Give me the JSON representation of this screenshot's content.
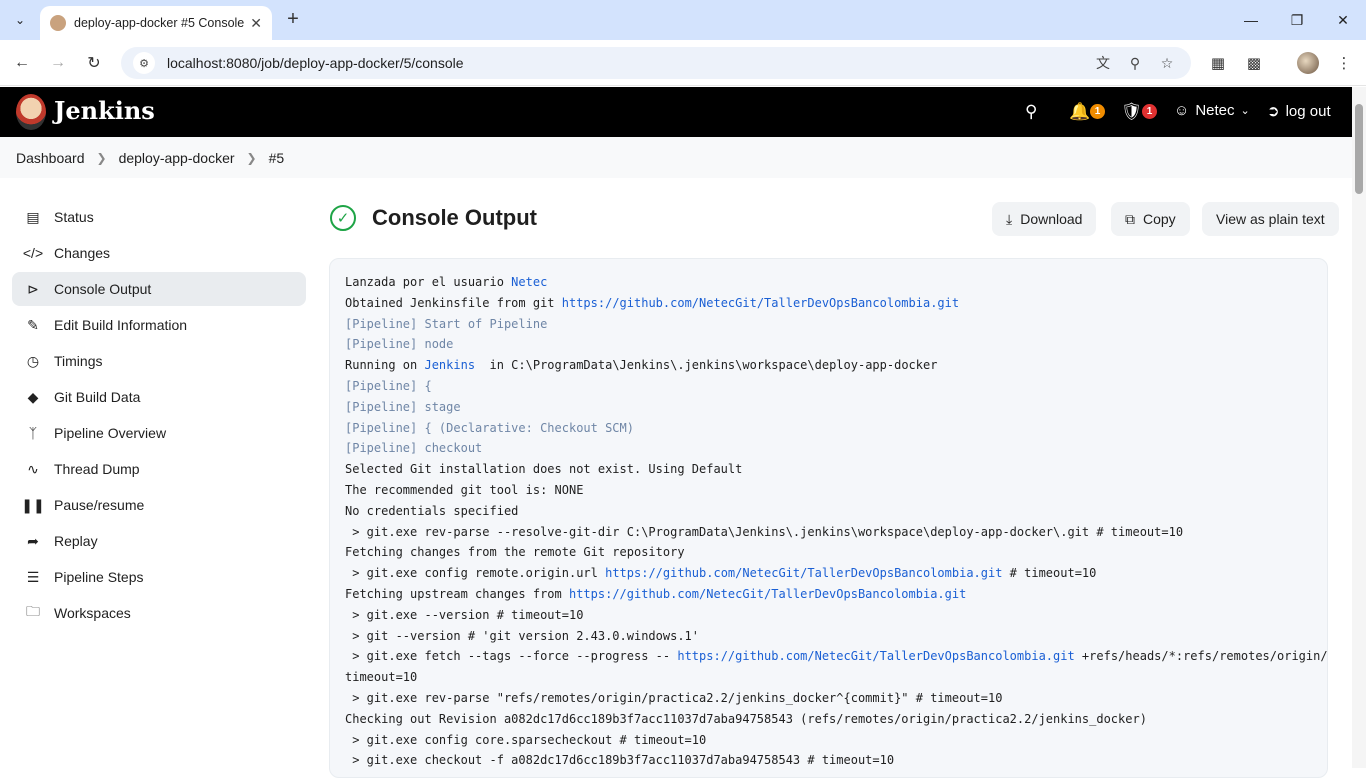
{
  "browser": {
    "tab_title": "deploy-app-docker #5 Console",
    "url": "localhost:8080/job/deploy-app-docker/5/console"
  },
  "jenkins": {
    "brand": "Jenkins",
    "notifications_count": "1",
    "security_count": "1",
    "user": "Netec",
    "logout": "log out"
  },
  "breadcrumb": [
    "Dashboard",
    "deploy-app-docker",
    "#5"
  ],
  "sidebar": {
    "items": [
      {
        "label": "Status",
        "icon": "document-icon"
      },
      {
        "label": "Changes",
        "icon": "code-icon"
      },
      {
        "label": "Console Output",
        "icon": "terminal-icon"
      },
      {
        "label": "Edit Build Information",
        "icon": "edit-icon"
      },
      {
        "label": "Timings",
        "icon": "stopwatch-icon"
      },
      {
        "label": "Git Build Data",
        "icon": "git-icon"
      },
      {
        "label": "Pipeline Overview",
        "icon": "branch-icon"
      },
      {
        "label": "Thread Dump",
        "icon": "pulse-icon"
      },
      {
        "label": "Pause/resume",
        "icon": "pause-icon"
      },
      {
        "label": "Replay",
        "icon": "replay-icon"
      },
      {
        "label": "Pipeline Steps",
        "icon": "list-icon"
      },
      {
        "label": "Workspaces",
        "icon": "folder-icon"
      }
    ]
  },
  "main": {
    "title": "Console Output",
    "download": "Download",
    "copy": "Copy",
    "plain": "View as plain text"
  },
  "console": {
    "l1a": "Lanzada por el usuario ",
    "l1b": "Netec",
    "l2a": "Obtained Jenkinsfile from git ",
    "l2b": "https://github.com/NetecGit/TallerDevOpsBancolombia.git",
    "l3": "[Pipeline] Start of Pipeline",
    "l4": "[Pipeline] node",
    "l5a": "Running on ",
    "l5b": "Jenkins",
    "l5c": "  in C:\\ProgramData\\Jenkins\\.jenkins\\workspace\\deploy-app-docker",
    "l6": "[Pipeline] {",
    "l7": "[Pipeline] stage",
    "l8": "[Pipeline] { (Declarative: Checkout SCM)",
    "l9": "[Pipeline] checkout",
    "l10": "Selected Git installation does not exist. Using Default",
    "l11": "The recommended git tool is: NONE",
    "l12": "No credentials specified",
    "l13": " > git.exe rev-parse --resolve-git-dir C:\\ProgramData\\Jenkins\\.jenkins\\workspace\\deploy-app-docker\\.git # timeout=10",
    "l14": "Fetching changes from the remote Git repository",
    "l15a": " > git.exe config remote.origin.url ",
    "l15b": "https://github.com/NetecGit/TallerDevOpsBancolombia.git",
    "l15c": " # timeout=10",
    "l16a": "Fetching upstream changes from ",
    "l16b": "https://github.com/NetecGit/TallerDevOpsBancolombia.git",
    "l17": " > git.exe --version # timeout=10",
    "l18": " > git --version # 'git version 2.43.0.windows.1'",
    "l19a": " > git.exe fetch --tags --force --progress -- ",
    "l19b": "https://github.com/NetecGit/TallerDevOpsBancolombia.git",
    "l19c": " +refs/heads/*:refs/remotes/origin/* #",
    "l19d": "timeout=10",
    "l20": " > git.exe rev-parse \"refs/remotes/origin/practica2.2/jenkins_docker^{commit}\" # timeout=10",
    "l21": "Checking out Revision a082dc17d6cc189b3f7acc11037d7aba94758543 (refs/remotes/origin/practica2.2/jenkins_docker)",
    "l22": " > git.exe config core.sparsecheckout # timeout=10",
    "l23": " > git.exe checkout -f a082dc17d6cc189b3f7acc11037d7aba94758543 # timeout=10"
  }
}
